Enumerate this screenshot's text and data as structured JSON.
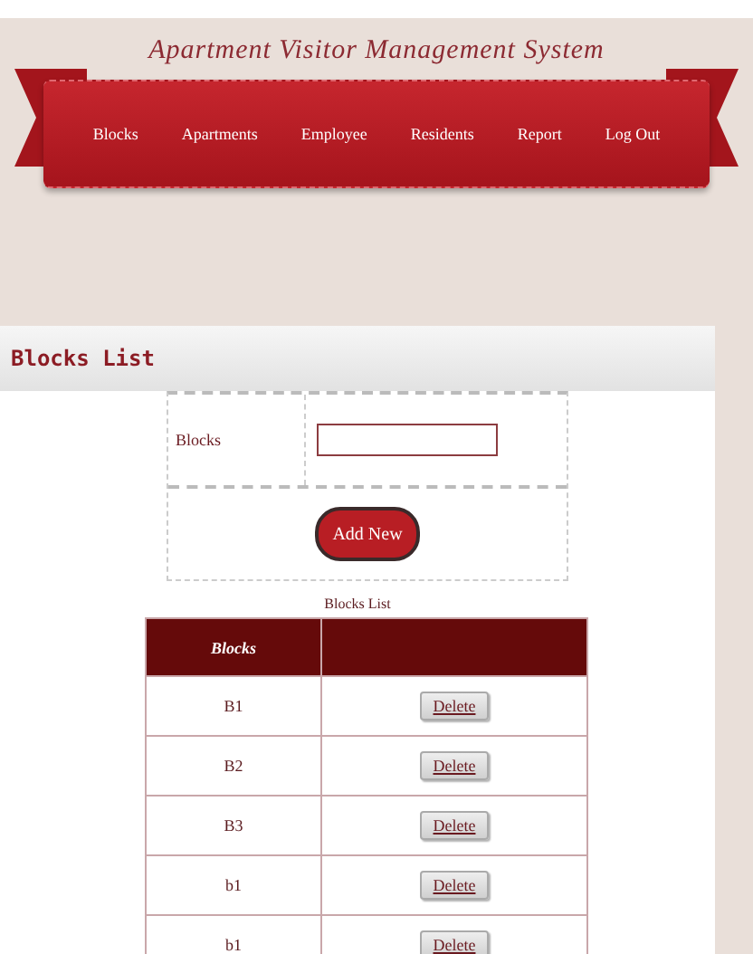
{
  "header": {
    "title": "Apartment Visitor Management System"
  },
  "nav": [
    {
      "label": "Blocks"
    },
    {
      "label": "Apartments"
    },
    {
      "label": "Employee"
    },
    {
      "label": "Residents"
    },
    {
      "label": "Report"
    },
    {
      "label": "Log Out"
    }
  ],
  "panel": {
    "title": "Blocks List"
  },
  "form": {
    "label": "Blocks",
    "button": "Add New"
  },
  "table": {
    "caption": "Blocks List",
    "columns": [
      "Blocks"
    ],
    "rows": [
      {
        "name": "B1",
        "action": "Delete"
      },
      {
        "name": "B2",
        "action": "Delete"
      },
      {
        "name": "B3",
        "action": "Delete"
      },
      {
        "name": "b1",
        "action": "Delete"
      },
      {
        "name": "b1",
        "action": "Delete"
      }
    ]
  }
}
